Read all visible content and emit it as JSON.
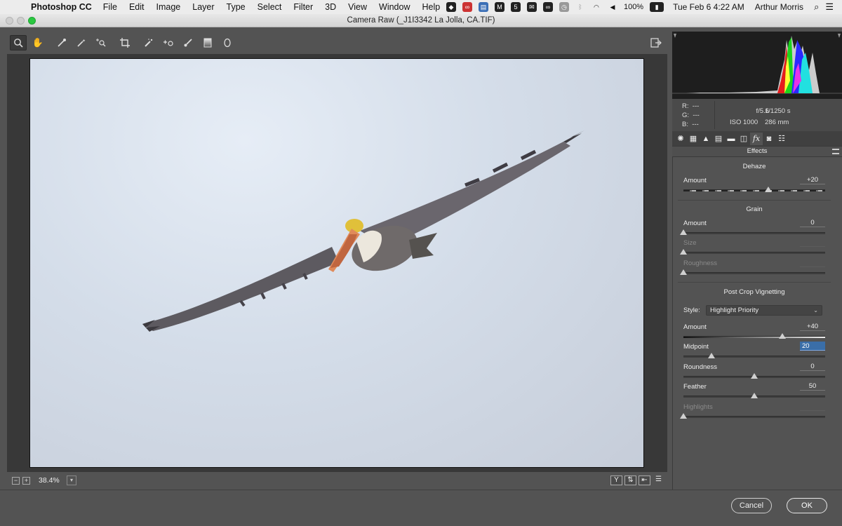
{
  "menubar": {
    "app": "Photoshop CC",
    "items": [
      "File",
      "Edit",
      "Image",
      "Layer",
      "Type",
      "Select",
      "Filter",
      "3D",
      "View",
      "Window",
      "Help"
    ],
    "battery": "100%",
    "datetime": "Tue Feb 6  4:22 AM",
    "user": "Arthur Morris"
  },
  "window": {
    "title": "Camera Raw (_J1I3342  La Jolla, CA.TIF)"
  },
  "toolbar": {
    "tools": [
      "zoom-icon",
      "hand-icon",
      "white-balance-icon",
      "color-sampler-icon",
      "targeted-adjust-icon",
      "crop-icon",
      "spot-removal-icon",
      "red-eye-icon",
      "adjustment-brush-icon",
      "graduated-filter-icon",
      "radial-filter-icon"
    ],
    "selected": "zoom-icon"
  },
  "statusbar": {
    "zoom": "38.4%",
    "view_y": "Y"
  },
  "info": {
    "r_label": "R:",
    "r_val": "---",
    "g_label": "G:",
    "g_val": "---",
    "b_label": "B:",
    "b_val": "---",
    "aperture": "f/5.6",
    "shutter": "1/1250 s",
    "iso": "ISO 1000",
    "focal": "286 mm"
  },
  "panel": {
    "title": "Effects",
    "fx_label": "fx",
    "dehaze": {
      "heading": "Dehaze",
      "amount_label": "Amount",
      "amount_value": "+20",
      "amount_level": 0.6
    },
    "grain": {
      "heading": "Grain",
      "amount_label": "Amount",
      "amount_value": "0",
      "amount_level": 0,
      "size_label": "Size",
      "size_level": 0,
      "roughness_label": "Roughness",
      "roughness_level": 0
    },
    "vignette": {
      "heading": "Post Crop Vignetting",
      "style_label": "Style:",
      "style_value": "Highlight Priority",
      "amount_label": "Amount",
      "amount_value": "+40",
      "amount_level": 0.7,
      "midpoint_label": "Midpoint",
      "midpoint_value": "20",
      "midpoint_level": 0.2,
      "roundness_label": "Roundness",
      "roundness_value": "0",
      "roundness_level": 0.5,
      "feather_label": "Feather",
      "feather_value": "50",
      "feather_level": 0.5,
      "highlights_label": "Highlights",
      "highlights_level": 0
    }
  },
  "buttons": {
    "cancel": "Cancel",
    "ok": "OK"
  }
}
